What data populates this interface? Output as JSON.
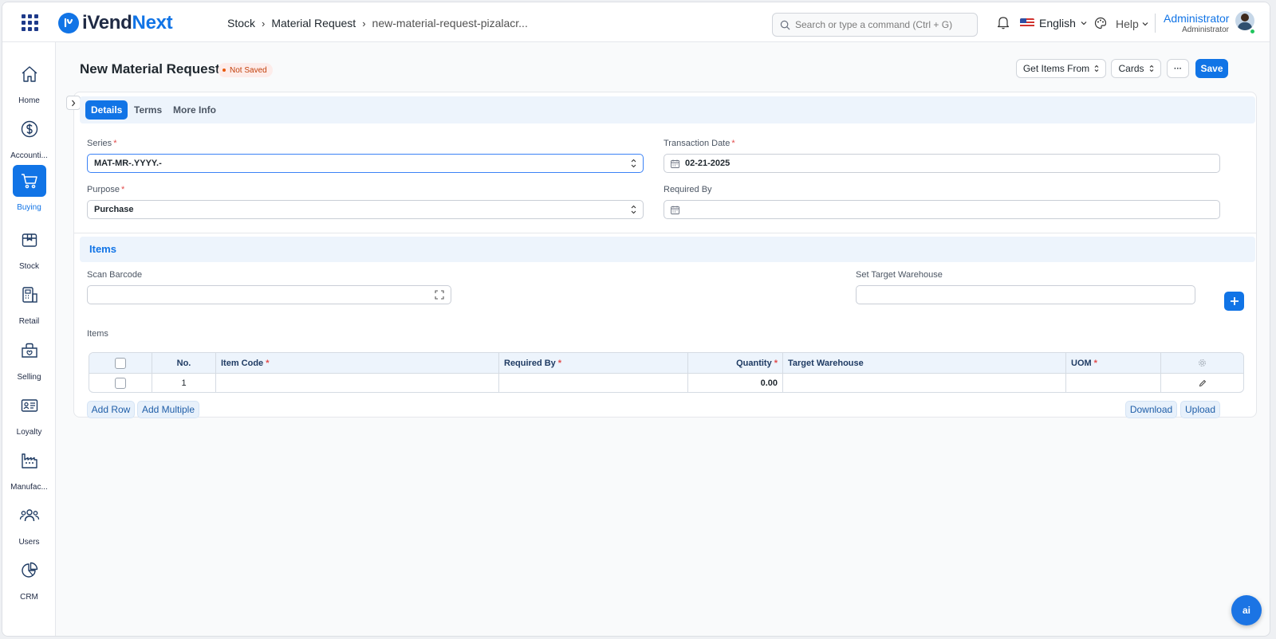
{
  "brand": {
    "name_part1": "iVend",
    "name_part2": "Next"
  },
  "breadcrumbs": [
    "Stock",
    "Material Request",
    "new-material-request-pizalacr..."
  ],
  "search": {
    "placeholder": "Search or type a command (Ctrl + G)"
  },
  "language": "English",
  "help_label": "Help",
  "user": {
    "name": "Administrator",
    "role": "Administrator"
  },
  "sidebar": {
    "items": [
      {
        "label": "Home",
        "icon": "home-icon"
      },
      {
        "label": "Accounti...",
        "icon": "dollar-icon"
      },
      {
        "label": "Buying",
        "icon": "cart-icon",
        "active": true
      },
      {
        "label": "Stock",
        "icon": "box-icon"
      },
      {
        "label": "Retail",
        "icon": "store-icon"
      },
      {
        "label": "Selling",
        "icon": "bag-icon"
      },
      {
        "label": "Loyalty",
        "icon": "id-card-icon"
      },
      {
        "label": "Manufac...",
        "icon": "factory-icon"
      },
      {
        "label": "Users",
        "icon": "users-icon"
      },
      {
        "label": "CRM",
        "icon": "pie-chart-icon"
      }
    ]
  },
  "page": {
    "title": "New Material Request",
    "status": "Not Saved"
  },
  "actions": {
    "get_items_from": "Get Items From",
    "cards": "Cards",
    "more": "···",
    "save": "Save"
  },
  "tabs": [
    "Details",
    "Terms",
    "More Info"
  ],
  "form": {
    "series": {
      "label": "Series",
      "value": "MAT-MR-.YYYY.-"
    },
    "transaction_date": {
      "label": "Transaction Date",
      "value": "02-21-2025"
    },
    "purpose": {
      "label": "Purpose",
      "value": "Purchase"
    },
    "required_by": {
      "label": "Required By",
      "value": ""
    }
  },
  "items_section": {
    "title": "Items",
    "scan_barcode_label": "Scan Barcode",
    "set_target_warehouse_label": "Set Target Warehouse",
    "table_label": "Items",
    "columns": [
      "No.",
      "Item Code",
      "Required By",
      "Quantity",
      "Target Warehouse",
      "UOM"
    ],
    "rows": [
      {
        "no": "1",
        "item_code": "",
        "required_by": "",
        "quantity": "0.00",
        "target_warehouse": "",
        "uom": ""
      }
    ],
    "add_row": "Add Row",
    "add_multiple": "Add Multiple",
    "download": "Download",
    "upload": "Upload"
  },
  "ai_button": "ai"
}
